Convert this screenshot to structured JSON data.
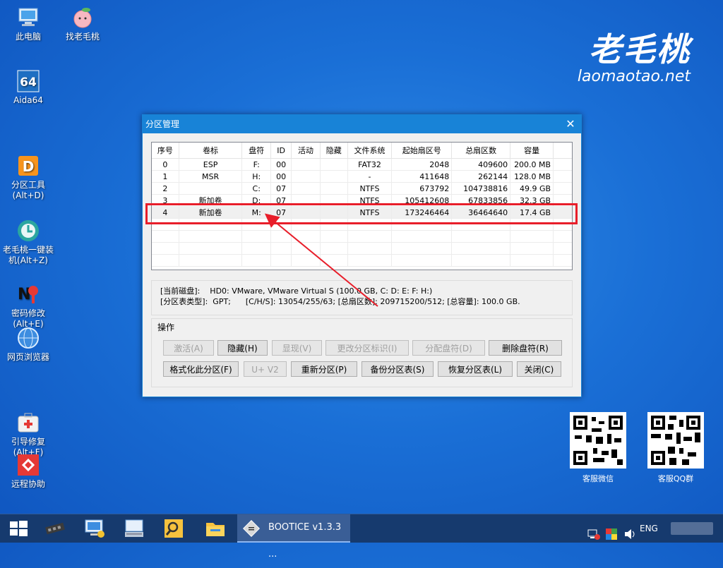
{
  "desktop": {
    "icons": [
      {
        "label": "此电脑",
        "icon": "computer-icon"
      },
      {
        "label": "找老毛桃",
        "icon": "peach-icon"
      },
      {
        "label": "Aida64",
        "icon": "aida64-icon"
      },
      {
        "label": "分区工具\n(Alt+D)",
        "icon": "partition-tool-icon"
      },
      {
        "label": "老毛桃一键装\n机(Alt+Z)",
        "icon": "installer-icon"
      },
      {
        "label": "密码修改\n(Alt+E)",
        "icon": "password-icon"
      },
      {
        "label": "网页浏览器",
        "icon": "browser-icon"
      },
      {
        "label": "引导修复\n(Alt+F)",
        "icon": "boot-repair-icon"
      },
      {
        "label": "远程协助",
        "icon": "remote-assist-icon"
      }
    ],
    "brand": {
      "logo": "老毛桃",
      "domain": "laomaotao.net"
    },
    "qr": [
      {
        "label": "客服微信"
      },
      {
        "label": "客服QQ群"
      }
    ]
  },
  "dialog": {
    "title": "分区管理",
    "close_icon": "close-icon",
    "table": {
      "columns": [
        "序号",
        "卷标",
        "盘符",
        "ID",
        "活动",
        "隐藏",
        "文件系统",
        "起始扇区号",
        "总扇区数",
        "容量"
      ],
      "rows": [
        [
          "0",
          "ESP",
          "F:",
          "00",
          "",
          "",
          "FAT32",
          "2048",
          "409600",
          "200.0 MB"
        ],
        [
          "1",
          "MSR",
          "H:",
          "00",
          "",
          "",
          "-",
          "411648",
          "262144",
          "128.0 MB"
        ],
        [
          "2",
          "",
          "C:",
          "07",
          "",
          "",
          "NTFS",
          "673792",
          "104738816",
          "49.9 GB"
        ],
        [
          "3",
          "新加卷",
          "D:",
          "07",
          "",
          "",
          "NTFS",
          "105412608",
          "67833856",
          "32.3 GB"
        ],
        [
          "4",
          "新加卷",
          "M:",
          "07",
          "",
          "",
          "NTFS",
          "173246464",
          "36464640",
          "17.4 GB"
        ]
      ],
      "highlighted_row": 4
    },
    "info": {
      "line1_label": "[当前磁盘]:",
      "line1_value": "HD0: VMware, VMware Virtual S (100.0 GB, C: D: E: F: H:)",
      "line2_label": "[分区表类型]:",
      "line2_value": "GPT;      [C/H/S]: 13054/255/63; [总扇区数]: 209715200/512; [总容量]: 100.0 GB."
    },
    "operations": {
      "title": "操作",
      "buttons_row1": [
        {
          "label": "激活(A)",
          "enabled": false
        },
        {
          "label": "隐藏(H)",
          "enabled": true
        },
        {
          "label": "显现(V)",
          "enabled": false
        },
        {
          "label": "更改分区标识(I)",
          "enabled": false
        },
        {
          "label": "分配盘符(D)",
          "enabled": false
        },
        {
          "label": "删除盘符(R)",
          "enabled": true
        }
      ],
      "buttons_row2": [
        {
          "label": "格式化此分区(F)",
          "enabled": true
        },
        {
          "label": "U+ V2",
          "enabled": false
        },
        {
          "label": "重新分区(P)",
          "enabled": true
        },
        {
          "label": "备份分区表(S)",
          "enabled": true
        },
        {
          "label": "恢复分区表(L)",
          "enabled": true
        },
        {
          "label": "关闭(C)",
          "enabled": true
        }
      ]
    }
  },
  "taskbar": {
    "start_icon": "windows-start-icon",
    "pinned": [
      "memory-icon",
      "network-computer-icon",
      "keyboard-settings-icon",
      "search-tool-icon",
      "folder-icon"
    ],
    "active_app": "BOOTICE v1.3.3 ...",
    "tray": {
      "lang": "ENG"
    }
  },
  "colors": {
    "accent": "#1883d7",
    "highlight": "#e81e2a",
    "desktop": "#1a6fd6"
  }
}
